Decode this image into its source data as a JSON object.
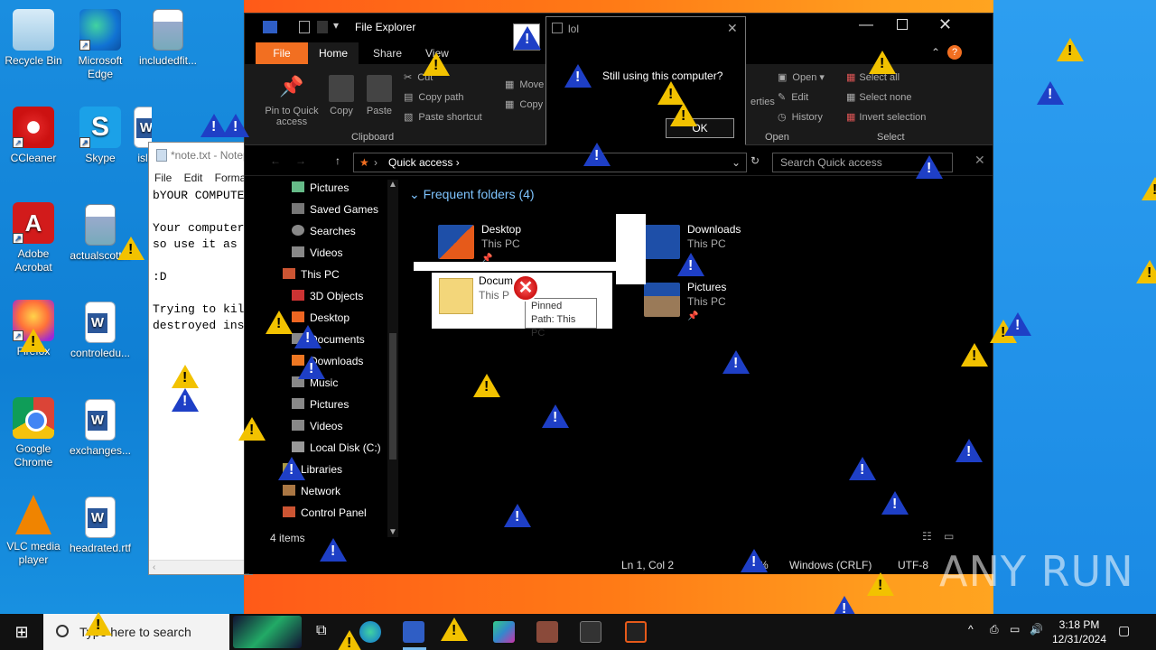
{
  "desktop": {
    "icons": [
      {
        "label": "Recycle Bin",
        "icon": "recycle-bin-icon"
      },
      {
        "label": "Microsoft Edge",
        "icon": "edge-icon"
      },
      {
        "label": "includedfit...",
        "icon": "image-file-icon"
      },
      {
        "label": "CCleaner",
        "icon": "ccleaner-icon"
      },
      {
        "label": "Skype",
        "icon": "skype-icon"
      },
      {
        "label": "isl",
        "icon": "word-doc-icon"
      },
      {
        "label": "Adobe Acrobat",
        "icon": "acrobat-icon"
      },
      {
        "label": "actualscott...",
        "icon": "image-file-icon"
      },
      {
        "label": "Firefox",
        "icon": "firefox-icon"
      },
      {
        "label": "controledu...",
        "icon": "word-doc-icon"
      },
      {
        "label": "Google Chrome",
        "icon": "chrome-icon"
      },
      {
        "label": "exchanges...",
        "icon": "word-doc-icon"
      },
      {
        "label": "VLC media player",
        "icon": "vlc-icon"
      },
      {
        "label": "headrated.rtf",
        "icon": "word-doc-icon"
      }
    ]
  },
  "notepad": {
    "title": "*note.txt - Notep",
    "menu": "File  Edit  Format",
    "text": "bYOUR COMPUTER\n\nYour computer w\nso use it as lo\n\n:D\n\nTrying to kill\ndestroyed insta"
  },
  "explorer": {
    "title": "File Explorer",
    "tabs": [
      "File",
      "Home",
      "Share",
      "View"
    ],
    "ribbon": {
      "pin_label": "Pin to Quick access",
      "copy": "Copy",
      "paste": "Paste",
      "cut": "Cut",
      "copy_path": "Copy path",
      "paste_shortcut": "Paste shortcut",
      "clipboard_group": "Clipboard",
      "move_to": "Move",
      "copy_to": "Copy t",
      "properties": "erties",
      "open": "Open",
      "edit": "Edit",
      "history": "History",
      "open_group": "Open",
      "select_all": "Select all",
      "select_none": "Select none",
      "invert_selection": "Invert selection",
      "select_group": "Select"
    },
    "address": "Quick access",
    "search_placeholder": "Search Quick access",
    "nav": [
      "Pictures",
      "Saved Games",
      "Searches",
      "Videos",
      "This PC",
      "3D Objects",
      "Desktop",
      "Documents",
      "Downloads",
      "Music",
      "Pictures",
      "Videos",
      "Local Disk (C:)",
      "Libraries",
      "Network",
      "Control Panel"
    ],
    "section_title": "Frequent folders (4)",
    "folders": [
      {
        "name": "Desktop",
        "location": "This PC"
      },
      {
        "name": "Downloads",
        "location": "This PC"
      },
      {
        "name": "Docum",
        "location": "This P"
      },
      {
        "name": "Pictures",
        "location": "This PC"
      }
    ],
    "tooltip_line1": "Pinned",
    "tooltip_line2": "Path: This PC",
    "item_count": "4 items"
  },
  "notepad_status": {
    "position": "Ln 1, Col 2",
    "zoom": "%",
    "line_endings": "Windows (CRLF)",
    "encoding": "UTF-8"
  },
  "dialog": {
    "title": "lol",
    "message": "Still using this computer?",
    "ok": "OK"
  },
  "taskbar": {
    "search_placeholder": "Type here to search",
    "time": "3:18 PM",
    "date": "12/31/2024"
  },
  "watermark": "ANY RUN"
}
